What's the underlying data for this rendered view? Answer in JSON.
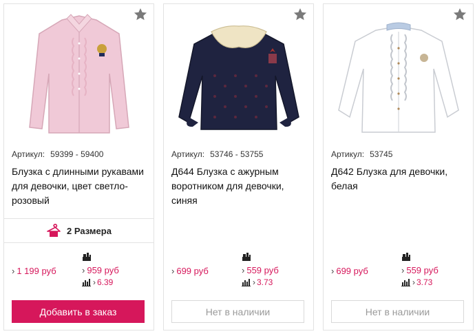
{
  "colors": {
    "accent": "#d6175b",
    "border": "#e2e2e2",
    "star": "#7a7a7a",
    "muted": "#9a9a9a"
  },
  "products": [
    {
      "image_icon": "pink-blouse-image",
      "sku_label": "Артикул:",
      "sku": "59399 - 59400",
      "title": "Блузка с длинными рукавами для девочки, цвет светло-розовый",
      "sizes_icon": "hanger-icon",
      "sizes_label": "2 Размера",
      "price": "1 199 руб",
      "wholesale_price": "959 руб",
      "points": "6.39",
      "button_label": "Добавить в заказ",
      "in_stock": true
    },
    {
      "image_icon": "navy-blouse-image",
      "sku_label": "Артикул:",
      "sku": "53746 - 53755",
      "title": "Д644 Блузка с ажурным воротником для девочки, синяя",
      "price": "699 руб",
      "wholesale_price": "559 руб",
      "points": "3.73",
      "button_label": "Нет в наличии",
      "in_stock": false
    },
    {
      "image_icon": "white-blouse-image",
      "sku_label": "Артикул:",
      "sku": "53745",
      "title": "Д642 Блузка для девочки, белая",
      "price": "699 руб",
      "wholesale_price": "559 руб",
      "points": "3.73",
      "button_label": "Нет в наличии",
      "in_stock": false
    }
  ]
}
